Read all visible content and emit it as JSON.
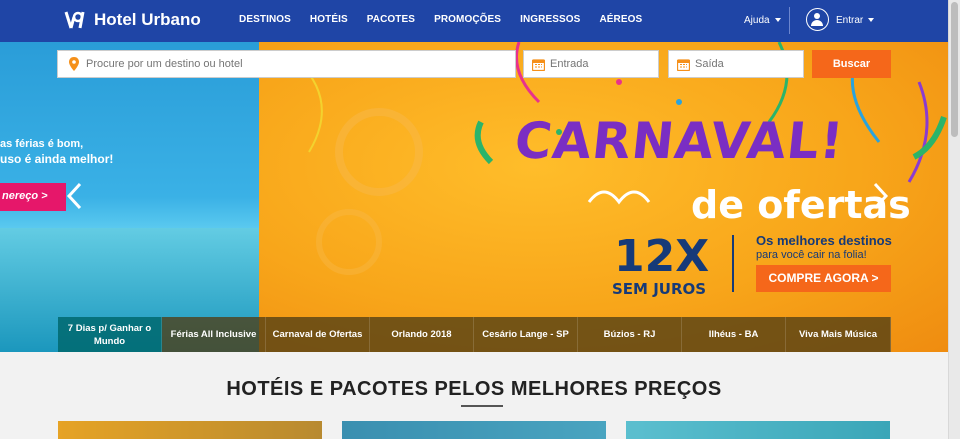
{
  "brand": {
    "name": "Hotel Urbano"
  },
  "nav": [
    "DESTINOS",
    "HOTÉIS",
    "PACOTES",
    "PROMOÇÕES",
    "INGRESSOS",
    "AÉREOS"
  ],
  "header": {
    "help": "Ajuda",
    "login": "Entrar"
  },
  "search": {
    "destination_placeholder": "Procure por um destino ou hotel",
    "checkin_placeholder": "Entrada",
    "checkout_placeholder": "Saída",
    "button": "Buscar"
  },
  "hero": {
    "left_line1": "as férias é bom,",
    "left_line2": "uso é ainda melhor!",
    "left_cta": "nereço >",
    "title": "CARNAVAL!",
    "subtitle": "de ofertas",
    "installments": "12X",
    "installments_note": "SEM JUROS",
    "best_destinations": "Os melhores destinos",
    "best_destinations_sub": "para você cair na folia!",
    "cta": "COMPRE AGORA >"
  },
  "carousel_tabs": [
    "7 Dias p/ Ganhar o Mundo",
    "Férias All Inclusive",
    "Carnaval de Ofertas",
    "Orlando 2018",
    "Cesário Lange - SP",
    "Búzios - RJ",
    "Ilhéus - BA",
    "Viva Mais Música"
  ],
  "section": {
    "title": "HOTÉIS E PACOTES PELOS MELHORES PREÇOS"
  },
  "colors": {
    "header": "#1f45a6",
    "accent": "#f5671a"
  }
}
